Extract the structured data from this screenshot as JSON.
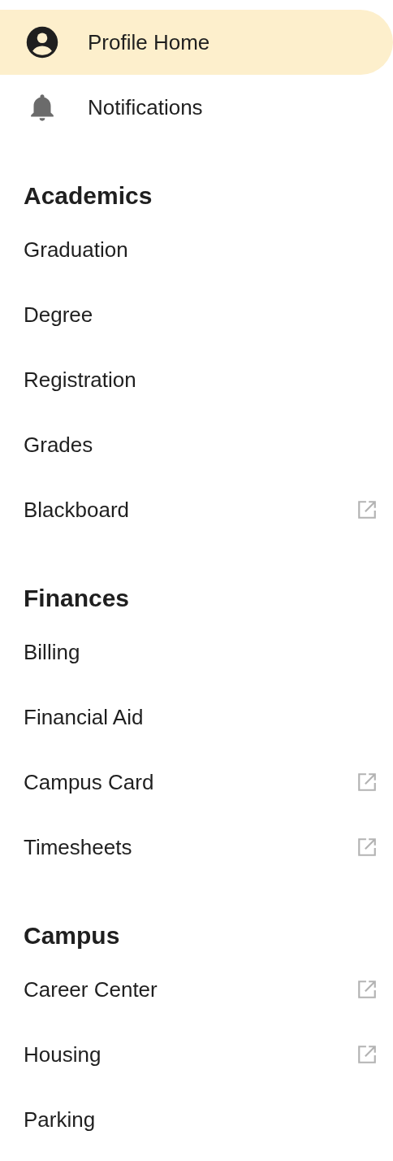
{
  "top_items": [
    {
      "label": "Profile Home",
      "kind": "account",
      "selected": true
    },
    {
      "label": "Notifications",
      "kind": "bell",
      "selected": false
    }
  ],
  "sections": [
    {
      "heading": "Academics",
      "items": [
        {
          "label": "Graduation",
          "external": false,
          "selected": false
        },
        {
          "label": "Degree",
          "external": false,
          "selected": false
        },
        {
          "label": "Registration",
          "external": false,
          "selected": false
        },
        {
          "label": "Grades",
          "external": false,
          "selected": false
        },
        {
          "label": "Blackboard",
          "external": true,
          "selected": false
        }
      ]
    },
    {
      "heading": "Finances",
      "items": [
        {
          "label": "Billing",
          "external": false,
          "selected": false
        },
        {
          "label": "Financial Aid",
          "external": false,
          "selected": false
        },
        {
          "label": "Campus Card",
          "external": true,
          "selected": false
        },
        {
          "label": "Timesheets",
          "external": true,
          "selected": false
        }
      ]
    },
    {
      "heading": "Campus",
      "items": [
        {
          "label": "Career Center",
          "external": true,
          "selected": false
        },
        {
          "label": "Housing",
          "external": true,
          "selected": false
        },
        {
          "label": "Parking",
          "external": false,
          "selected": false
        }
      ]
    }
  ]
}
